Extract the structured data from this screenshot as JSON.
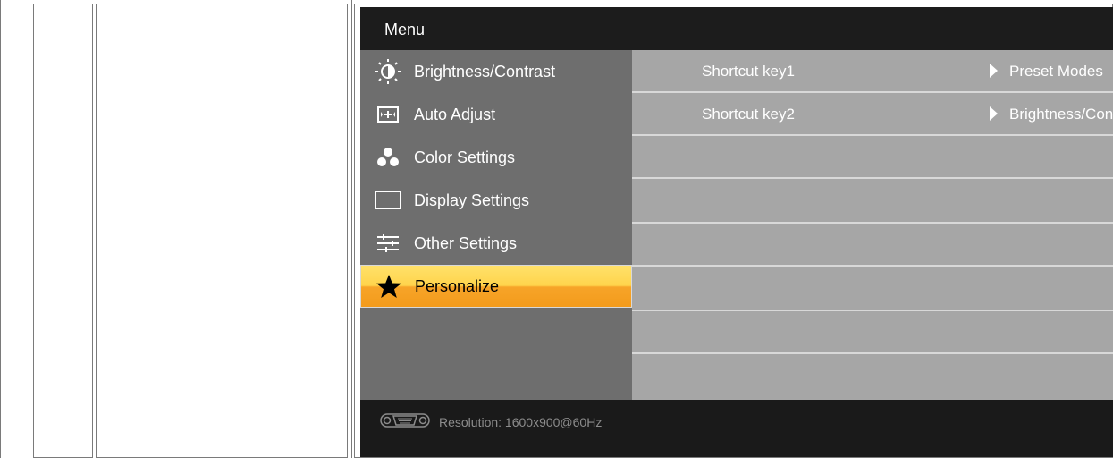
{
  "menu": {
    "title": "Menu",
    "items": [
      {
        "label": "Brightness/Contrast",
        "icon": "brightness-contrast-icon"
      },
      {
        "label": "Auto Adjust",
        "icon": "auto-adjust-icon"
      },
      {
        "label": "Color Settings",
        "icon": "color-settings-icon"
      },
      {
        "label": "Display Settings",
        "icon": "display-settings-icon"
      },
      {
        "label": "Other Settings",
        "icon": "other-settings-icon"
      },
      {
        "label": "Personalize",
        "icon": "star-icon",
        "selected": true
      }
    ]
  },
  "content": {
    "rows": [
      {
        "key": "Shortcut key1",
        "value": "Preset Modes"
      },
      {
        "key": "Shortcut key2",
        "value": "Brightness/Contrast"
      }
    ]
  },
  "footer": {
    "resolution_text": "Resolution:  1600x900@60Hz",
    "connector_icon": "vga-connector-icon"
  },
  "colors": {
    "menu_bg": "#6e6e6e",
    "content_bg": "#a6a6a6",
    "selected_top": "#ffe16a",
    "selected_bottom": "#f39b1c",
    "header_bg": "#1c1c1c"
  }
}
